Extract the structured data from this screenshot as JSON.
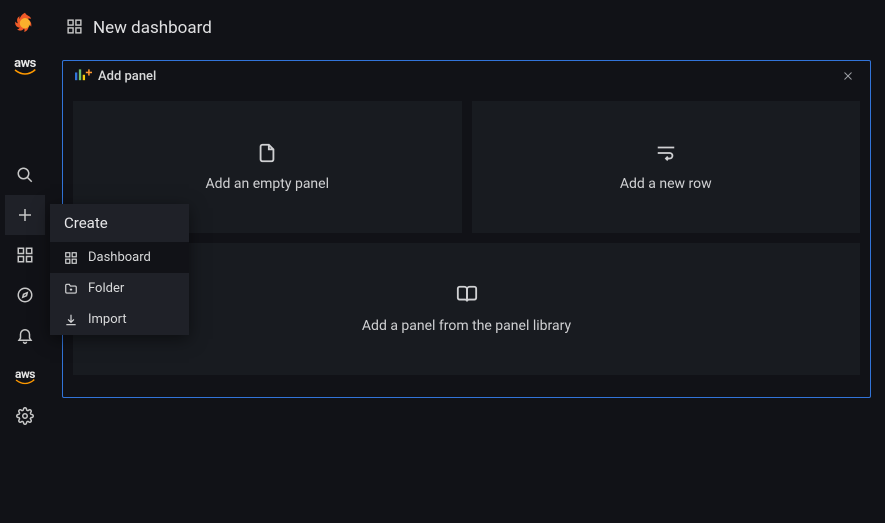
{
  "header": {
    "title": "New dashboard"
  },
  "panel": {
    "title": "Add panel",
    "add_empty": "Add an empty panel",
    "add_row": "Add a new row",
    "add_library": "Add a panel from the panel library"
  },
  "sidebar": {
    "aws": "aws",
    "aws2": "aws"
  },
  "flyout": {
    "title": "Create",
    "items": [
      {
        "label": "Dashboard"
      },
      {
        "label": "Folder"
      },
      {
        "label": "Import"
      }
    ]
  }
}
